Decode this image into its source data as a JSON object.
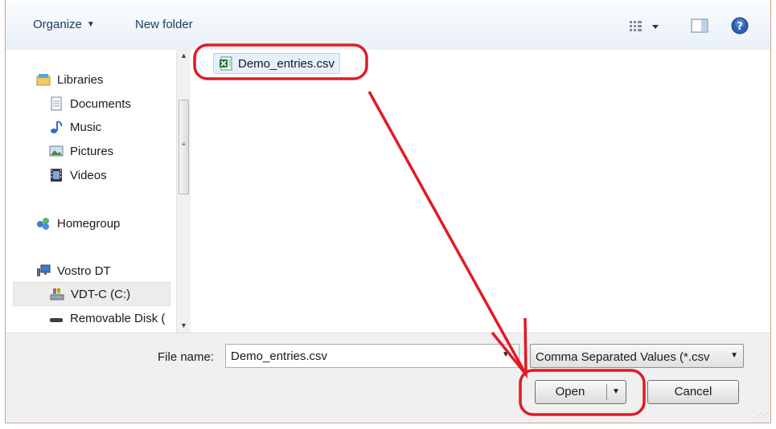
{
  "toolbar": {
    "organize_label": "Organize",
    "new_folder_label": "New folder"
  },
  "nav": {
    "libraries": "Libraries",
    "documents": "Documents",
    "music": "Music",
    "pictures": "Pictures",
    "videos": "Videos",
    "homegroup": "Homegroup",
    "computer": "Vostro DT",
    "drive_c": "VDT-C (C:)",
    "removable": "Removable Disk ("
  },
  "files": [
    {
      "name": "Demo_entries.csv",
      "icon": "excel-csv-icon"
    }
  ],
  "footer": {
    "file_name_label": "File name:",
    "file_name_value": "Demo_entries.csv",
    "file_type_value": "Comma Separated Values (*.csv",
    "open_label": "Open",
    "cancel_label": "Cancel"
  },
  "annotation": {
    "highlight_color": "#e01b24"
  }
}
